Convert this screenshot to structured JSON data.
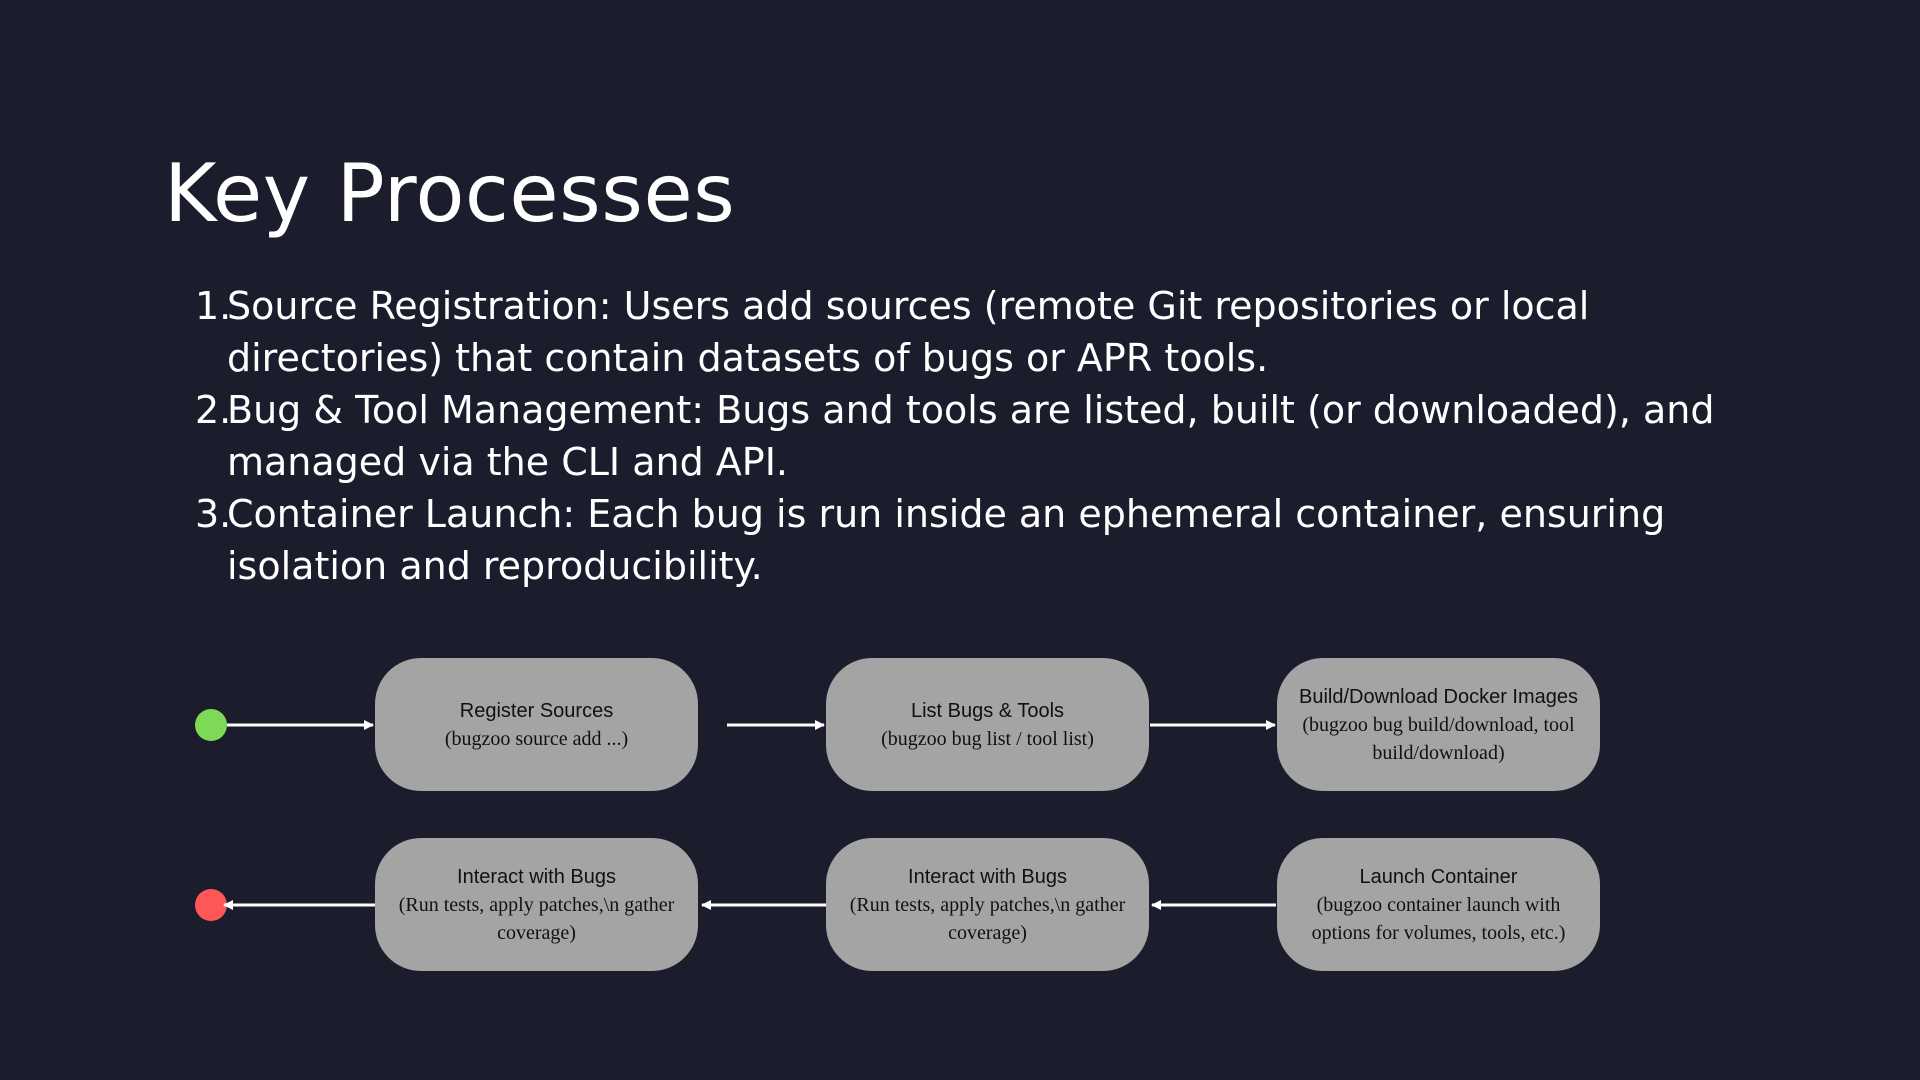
{
  "slide": {
    "title": "Key Processes",
    "items": [
      {
        "number": "1.",
        "text": "Source Registration: Users add sources (remote Git repositories or local directories) that contain datasets of bugs or APR tools."
      },
      {
        "number": "2.",
        "text": "Bug & Tool Management: Bugs and tools are listed, built (or downloaded), and managed via the CLI and API."
      },
      {
        "number": "3.",
        "text": "Container Launch: Each bug is run inside an ephemeral container, ensuring isolation and reproducibility."
      }
    ]
  },
  "diagram": {
    "colors": {
      "background": "#1b1d2d",
      "node_fill": "#a4a4a4",
      "start_dot": "#7ed957",
      "end_dot": "#ff5757",
      "arrow": "#ffffff"
    },
    "nodes": [
      {
        "title": "Register Sources",
        "subtitle": "(bugzoo source add ...)"
      },
      {
        "title": "List Bugs & Tools",
        "subtitle": "(bugzoo bug list / tool list)"
      },
      {
        "title": "Build/Download Docker Images",
        "subtitle": "(bugzoo bug build/download, tool build/download)"
      },
      {
        "title": "Launch Container",
        "subtitle": "(bugzoo container launch with options for volumes, tools, etc.)"
      },
      {
        "title": "Interact with Bugs",
        "subtitle": "(Run tests, apply patches,\\n gather coverage)"
      },
      {
        "title": "Interact with Bugs",
        "subtitle": "(Run tests, apply patches,\\n gather coverage)"
      }
    ]
  }
}
